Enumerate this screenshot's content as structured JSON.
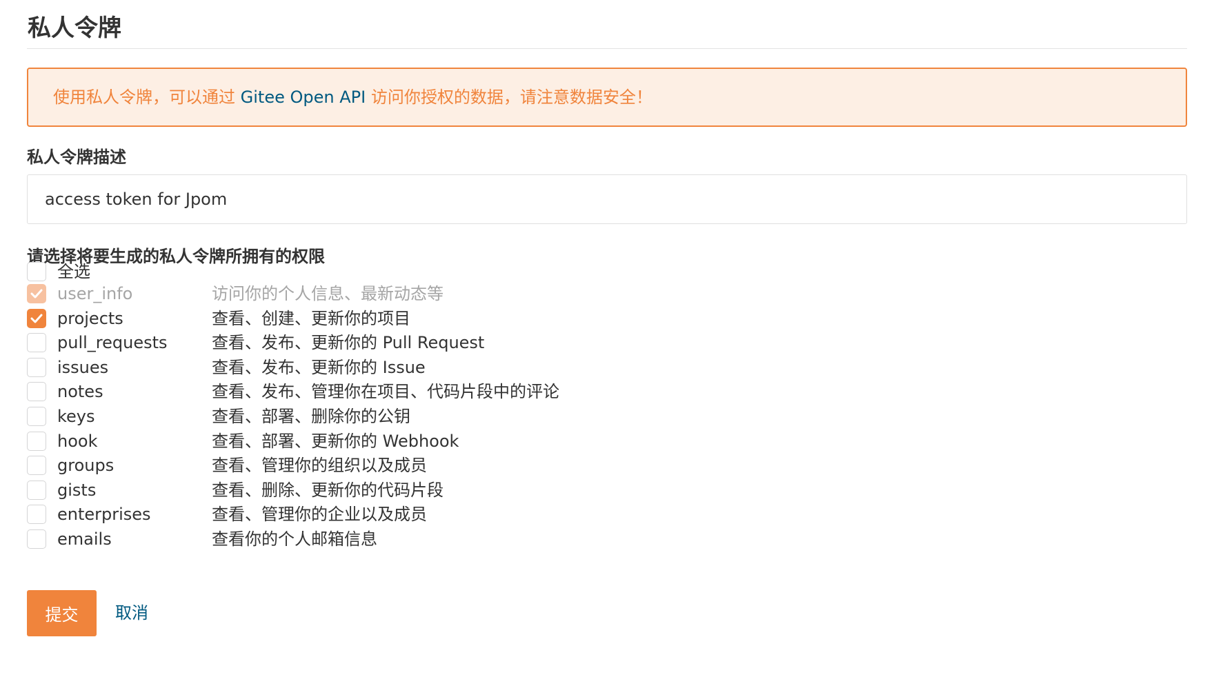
{
  "page": {
    "title": "私人令牌"
  },
  "notice": {
    "before": "使用私人令牌，可以通过 ",
    "link": "Gitee Open API",
    "after": " 访问你授权的数据，请注意数据安全！"
  },
  "form": {
    "description_label": "私人令牌描述",
    "description_value": "access token for Jpom",
    "scopes_label": "请选择将要生成的私人令牌所拥有的权限",
    "select_all_label": "全选",
    "scopes": [
      {
        "name": "user_info",
        "desc": "访问你的个人信息、最新动态等",
        "checked": true,
        "disabled": true
      },
      {
        "name": "projects",
        "desc": "查看、创建、更新你的项目",
        "checked": true,
        "disabled": false
      },
      {
        "name": "pull_requests",
        "desc": "查看、发布、更新你的 Pull Request",
        "checked": false,
        "disabled": false
      },
      {
        "name": "issues",
        "desc": "查看、发布、更新你的 Issue",
        "checked": false,
        "disabled": false
      },
      {
        "name": "notes",
        "desc": "查看、发布、管理你在项目、代码片段中的评论",
        "checked": false,
        "disabled": false
      },
      {
        "name": "keys",
        "desc": "查看、部署、删除你的公钥",
        "checked": false,
        "disabled": false
      },
      {
        "name": "hook",
        "desc": "查看、部署、更新你的 Webhook",
        "checked": false,
        "disabled": false
      },
      {
        "name": "groups",
        "desc": "查看、管理你的组织以及成员",
        "checked": false,
        "disabled": false
      },
      {
        "name": "gists",
        "desc": "查看、删除、更新你的代码片段",
        "checked": false,
        "disabled": false
      },
      {
        "name": "enterprises",
        "desc": "查看、管理你的企业以及成员",
        "checked": false,
        "disabled": false
      },
      {
        "name": "emails",
        "desc": "查看你的个人邮箱信息",
        "checked": false,
        "disabled": false
      }
    ],
    "submit_label": "提交",
    "cancel_label": "取消"
  },
  "colors": {
    "accent": "#f0843c",
    "notice_bg": "#fdefe4",
    "link": "#005980"
  },
  "icons": {
    "checkbox_check": "check-icon"
  }
}
